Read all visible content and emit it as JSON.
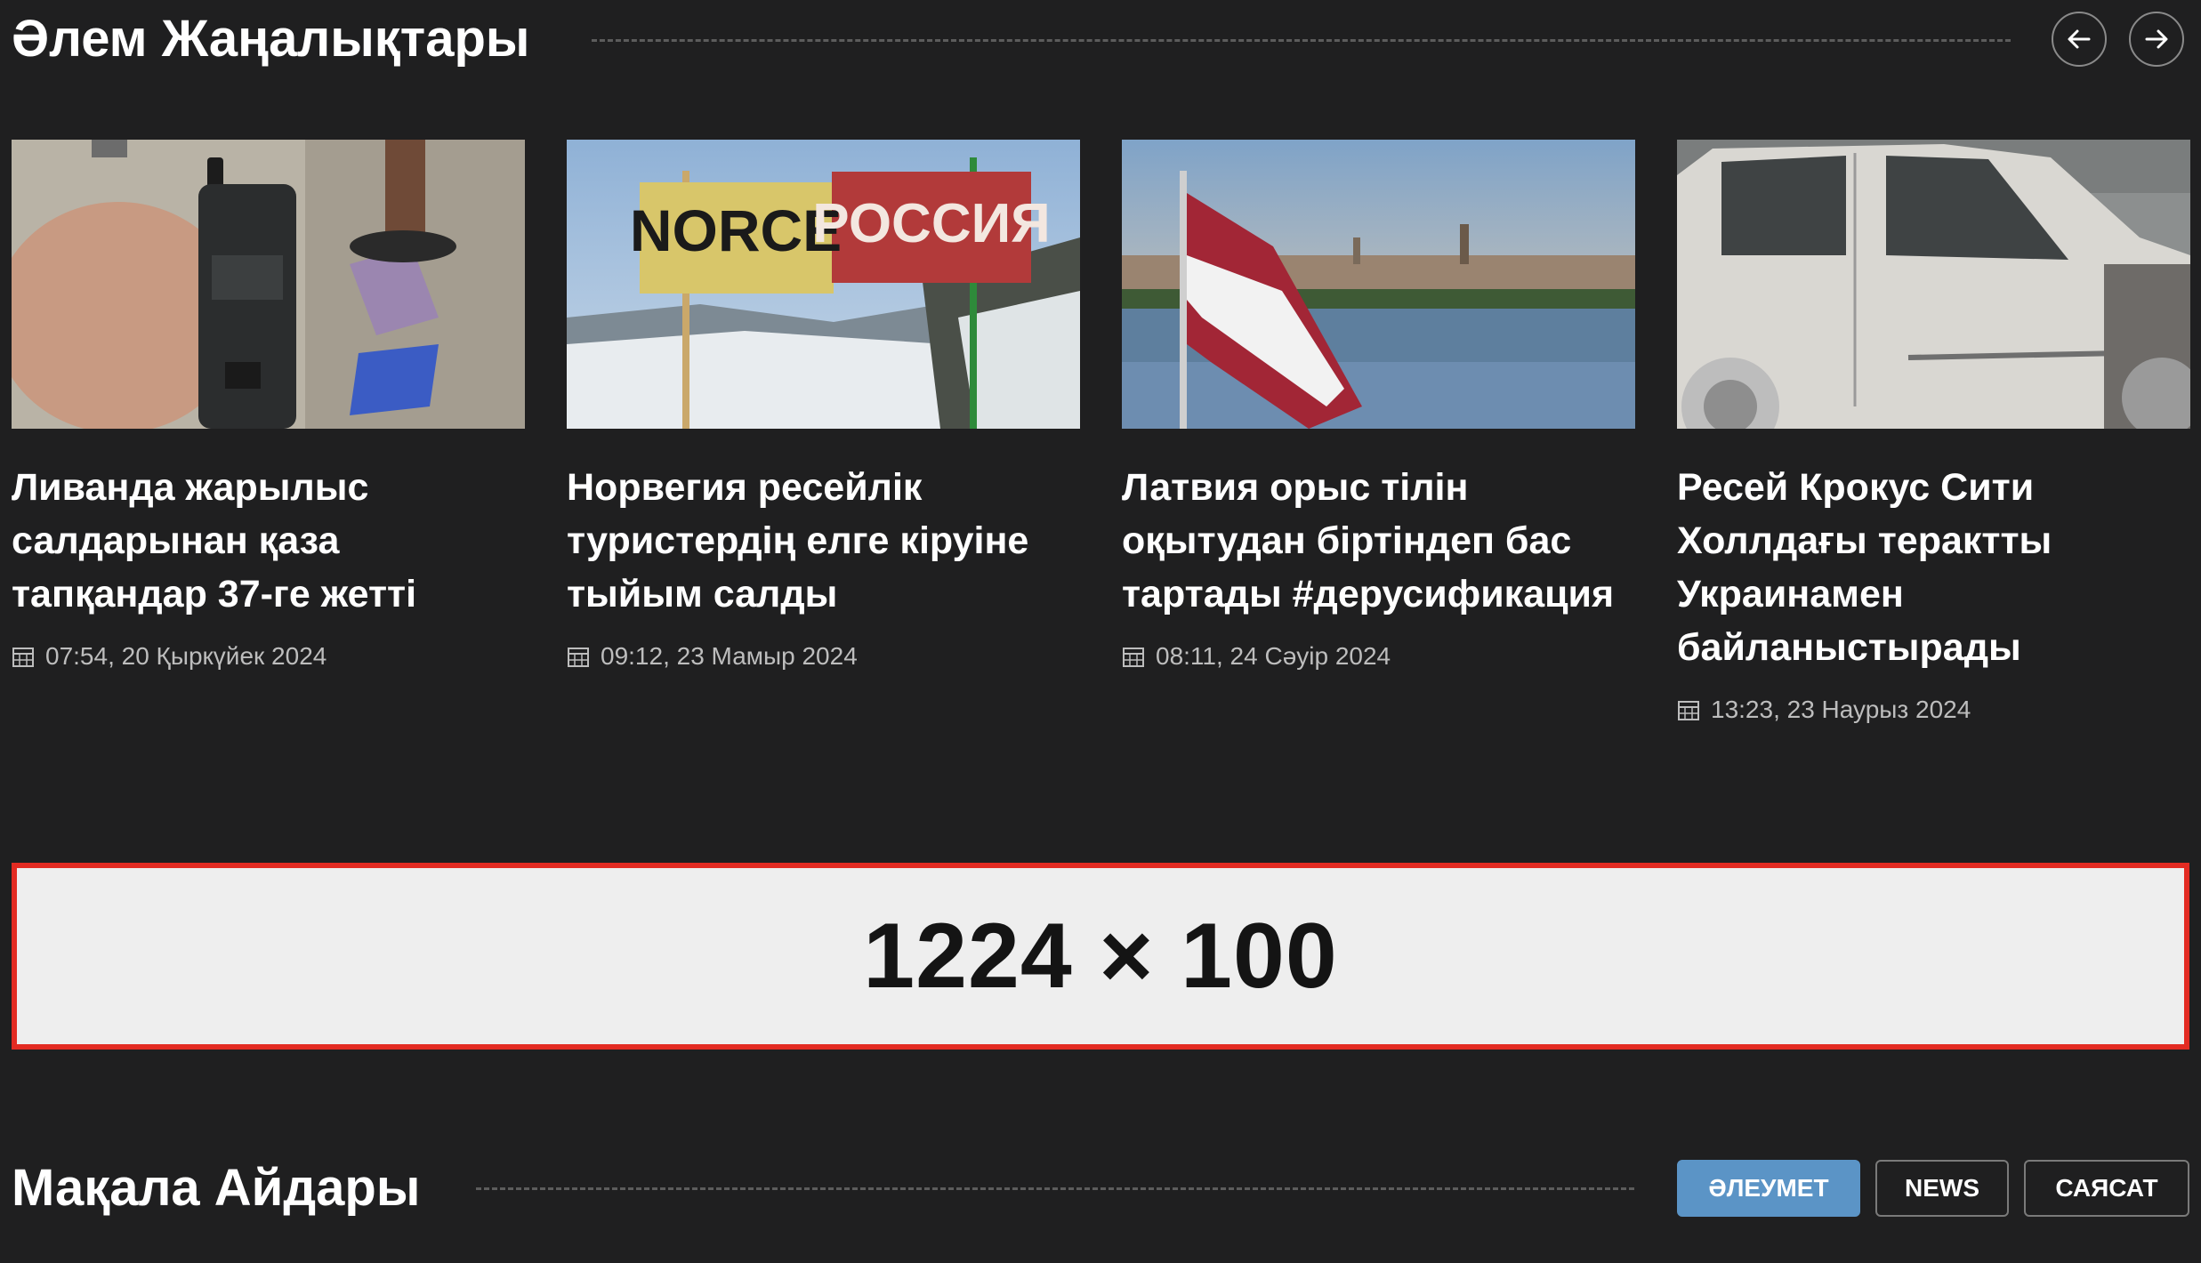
{
  "world_news": {
    "title": "Әлем Жаңалықтары",
    "prev_icon": "arrow-left-icon",
    "next_icon": "arrow-right-icon",
    "articles": [
      {
        "title": "Ливанда жарылыс салдарынан қаза тапқандар 37-ге жетті",
        "date": "07:54, 20 Қыркүйек 2024",
        "image": "pager-device-photo"
      },
      {
        "title": "Норвегия ресейлік туристердің елге кіруіне тыйым салды",
        "date": "09:12, 23 Мамыр 2024",
        "image": "border-sign-photo",
        "sign_left": "NORCE",
        "sign_right": "РОССИЯ"
      },
      {
        "title": "Латвия орыс тілін оқытудан біртіндеп бас тартады #дерусификация",
        "date": "08:11, 24 Сәуір 2024",
        "image": "latvian-flag-photo"
      },
      {
        "title": "Ресей Крокус Сити Холлдағы терактты Украинамен байланыстырады",
        "date": "13:23, 23 Наурыз 2024",
        "image": "burned-car-photo"
      }
    ]
  },
  "ad_banner": {
    "text": "1224 × 100"
  },
  "categories": {
    "title": "Мақала Айдары",
    "tabs": [
      {
        "label": "ӘЛЕУМЕТ",
        "active": true
      },
      {
        "label": "NEWS",
        "active": false
      },
      {
        "label": "САЯСАТ",
        "active": false
      }
    ]
  },
  "colors": {
    "background": "#1f1f20",
    "accent": "#5b94c6",
    "ad_border": "#e32b22"
  }
}
